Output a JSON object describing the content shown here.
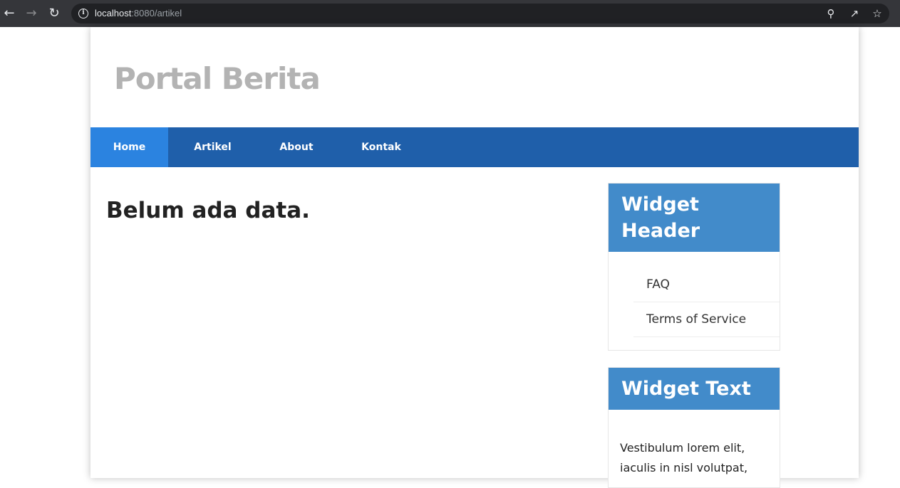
{
  "browser": {
    "url_host": "localhost",
    "url_rest": ":8080/artikel",
    "icons": [
      "back-arrow-icon",
      "forward-arrow-icon",
      "reload-icon",
      "info-icon",
      "zoom-icon",
      "share-icon",
      "star-icon"
    ]
  },
  "site": {
    "title": "Portal Berita"
  },
  "nav": {
    "items": [
      {
        "label": "Home",
        "active": true
      },
      {
        "label": "Artikel",
        "active": false
      },
      {
        "label": "About",
        "active": false
      },
      {
        "label": "Kontak",
        "active": false
      }
    ]
  },
  "main": {
    "heading": "Belum ada data."
  },
  "sidebar": {
    "widget_header": {
      "title": "Widget Header",
      "links": [
        "FAQ",
        "Terms of Service"
      ]
    },
    "widget_text": {
      "title": "Widget Text",
      "body": "Vestibulum lorem elit, iaculis in nisl volutpat,"
    }
  },
  "colors": {
    "navbar": "#1f5faa",
    "nav_active": "#2b83e0",
    "widget_header": "#428bca",
    "site_title": "#b3b3b3"
  }
}
